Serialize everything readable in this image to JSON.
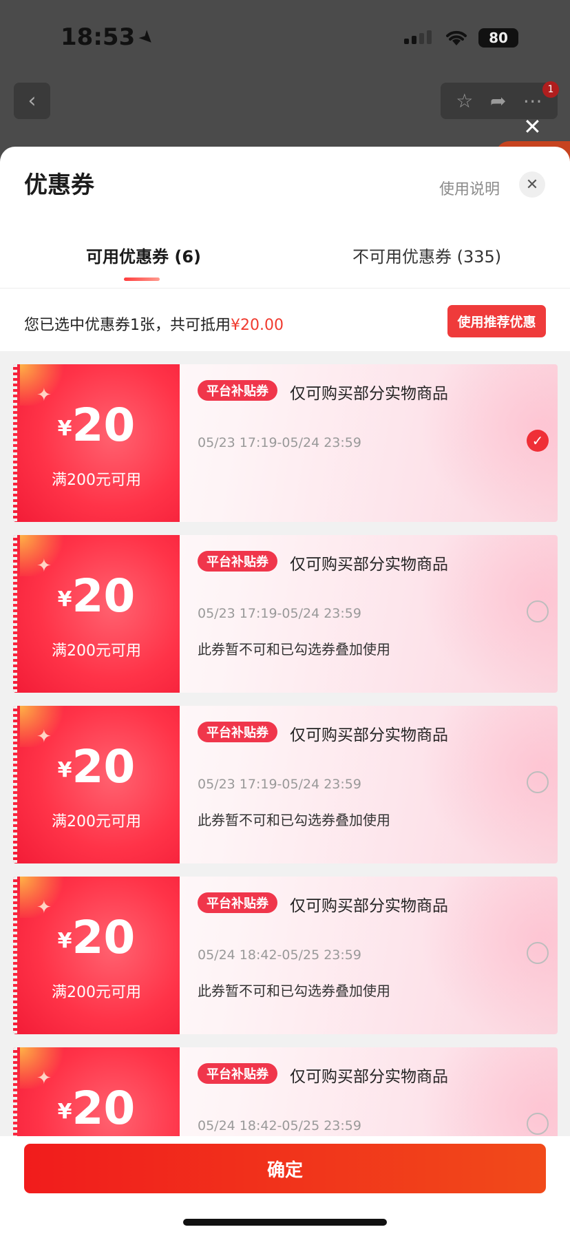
{
  "status_bar": {
    "time": "18:53",
    "battery": "80"
  },
  "nav": {
    "notification_count": "1"
  },
  "sheet": {
    "title": "优惠券",
    "help_link": "使用说明",
    "tabs": [
      {
        "label": "可用优惠券 (6)",
        "active": true
      },
      {
        "label": "不可用优惠券 (335)",
        "active": false
      }
    ],
    "summary": {
      "text": "您已选中优惠券1张，共可抵用",
      "amount": "¥20.00",
      "recommend_button": "使用推荐优惠"
    },
    "coupons": [
      {
        "currency": "¥",
        "amount": "20",
        "threshold": "满200元可用",
        "tag": "平台补贴券",
        "scope": "仅可购买部分实物商品",
        "validity": "05/23 17:19-05/24 23:59",
        "note": "",
        "selected": true
      },
      {
        "currency": "¥",
        "amount": "20",
        "threshold": "满200元可用",
        "tag": "平台补贴券",
        "scope": "仅可购买部分实物商品",
        "validity": "05/23 17:19-05/24 23:59",
        "note": "此券暂不可和已勾选券叠加使用",
        "selected": false
      },
      {
        "currency": "¥",
        "amount": "20",
        "threshold": "满200元可用",
        "tag": "平台补贴券",
        "scope": "仅可购买部分实物商品",
        "validity": "05/23 17:19-05/24 23:59",
        "note": "此券暂不可和已勾选券叠加使用",
        "selected": false
      },
      {
        "currency": "¥",
        "amount": "20",
        "threshold": "满200元可用",
        "tag": "平台补贴券",
        "scope": "仅可购买部分实物商品",
        "validity": "05/24 18:42-05/25 23:59",
        "note": "此券暂不可和已勾选券叠加使用",
        "selected": false
      },
      {
        "currency": "¥",
        "amount": "20",
        "threshold": "",
        "tag": "平台补贴券",
        "scope": "仅可购买部分实物商品",
        "validity": "05/24 18:42-05/25 23:59",
        "note": "",
        "selected": false
      }
    ],
    "confirm_button": "确定"
  },
  "colors": {
    "accent": "#ef3b3b",
    "price": "#f03a2e"
  }
}
